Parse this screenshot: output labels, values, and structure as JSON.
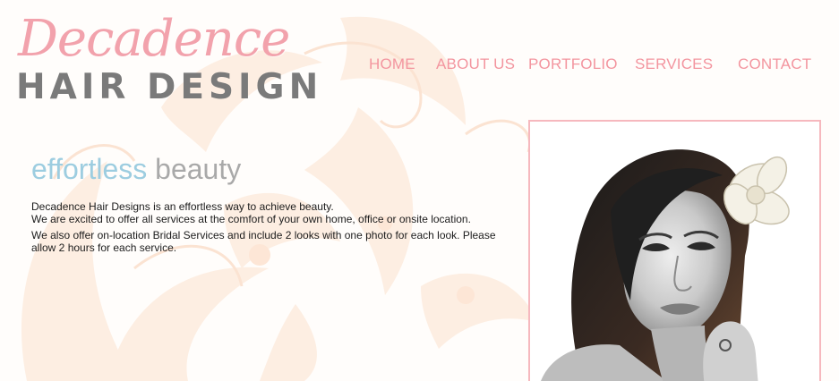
{
  "logo": {
    "script_text": "Decadence",
    "block_text": "HAIR DESIGN"
  },
  "nav": {
    "items": [
      {
        "label": "HOME"
      },
      {
        "label": "ABOUT US"
      },
      {
        "label": "PORTFOLIO"
      },
      {
        "label": "SERVICES"
      },
      {
        "label": "CONTACT"
      }
    ]
  },
  "hero": {
    "tagline_part1": "effortless",
    "tagline_part2": "beauty",
    "paragraphs": [
      "Decadence Hair Designs is an effortless way to achieve beauty.",
      "We are excited to offer all services at the comfort of your own home, office or onsite location.",
      "We also offer on-location Bridal Services and include 2 looks with one photo for each look. Please allow 2 hours for each service."
    ]
  },
  "colors": {
    "accent_pink": "#f3959f",
    "logo_pink": "#f2a2ac",
    "logo_gray": "#7a7a7a",
    "tagline_blue": "#9dcde0",
    "tagline_gray": "#a9a9a9",
    "floral_peach": "#fde9da"
  },
  "photo": {
    "icon": "portrait-photo"
  }
}
